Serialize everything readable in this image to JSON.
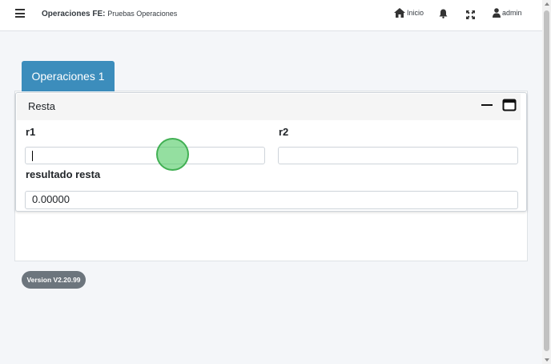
{
  "header": {
    "app_name": "Operaciones FE:",
    "page_name": "Pruebas Operaciones",
    "home_label": "Inicio",
    "user_label": "admin",
    "icons": [
      "menu-icon",
      "home-icon",
      "bell-icon",
      "expand-icon",
      "user-icon"
    ]
  },
  "tabs": [
    {
      "label": "Operaciones 1",
      "active": true
    }
  ],
  "card": {
    "title": "Resta",
    "fields": {
      "r1": {
        "label": "r1",
        "value": ""
      },
      "r2": {
        "label": "r2",
        "value": ""
      },
      "resultado": {
        "label": "resultado resta",
        "value": "0.00000"
      }
    }
  },
  "footer": {
    "version": "Version V2.20.99"
  },
  "colors": {
    "accent": "#3c8dbc",
    "badge": "#6c757d",
    "touch": "#4cc960"
  }
}
